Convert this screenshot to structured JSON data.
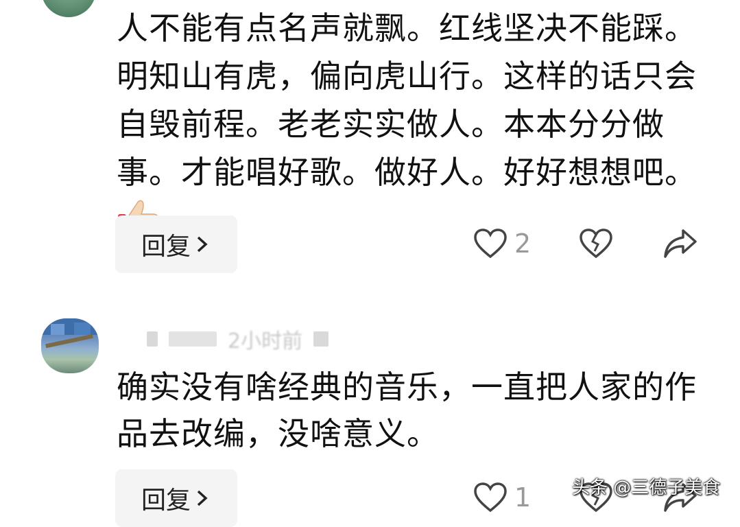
{
  "comments": [
    {
      "text": "人不能有点名声就飘。红线坚决不能踩。明知山有虎，偏向虎山行。这样的话只会自毁前程。老老实实做人。本本分分做事。才能唱好歌。做好人。好好想想吧。",
      "reply_label": "回复",
      "like_count": "2"
    },
    {
      "meta_time": "2小时前",
      "text": "确实没有啥经典的音乐，一直把人家的作品去改编，没啥意义。",
      "reply_label": "回复",
      "like_count": "1"
    }
  ],
  "watermark": "头条 @三德子美食",
  "icons": {
    "like": "heart-outline-icon",
    "dislike": "broken-heart-icon",
    "share": "share-arrow-icon",
    "reply_chevron": "chevron-right-icon",
    "thumb": "thumbs-up-emoji-icon"
  },
  "colors": {
    "text": "#111111",
    "muted": "#999999",
    "button_bg": "#f4f4f4"
  }
}
